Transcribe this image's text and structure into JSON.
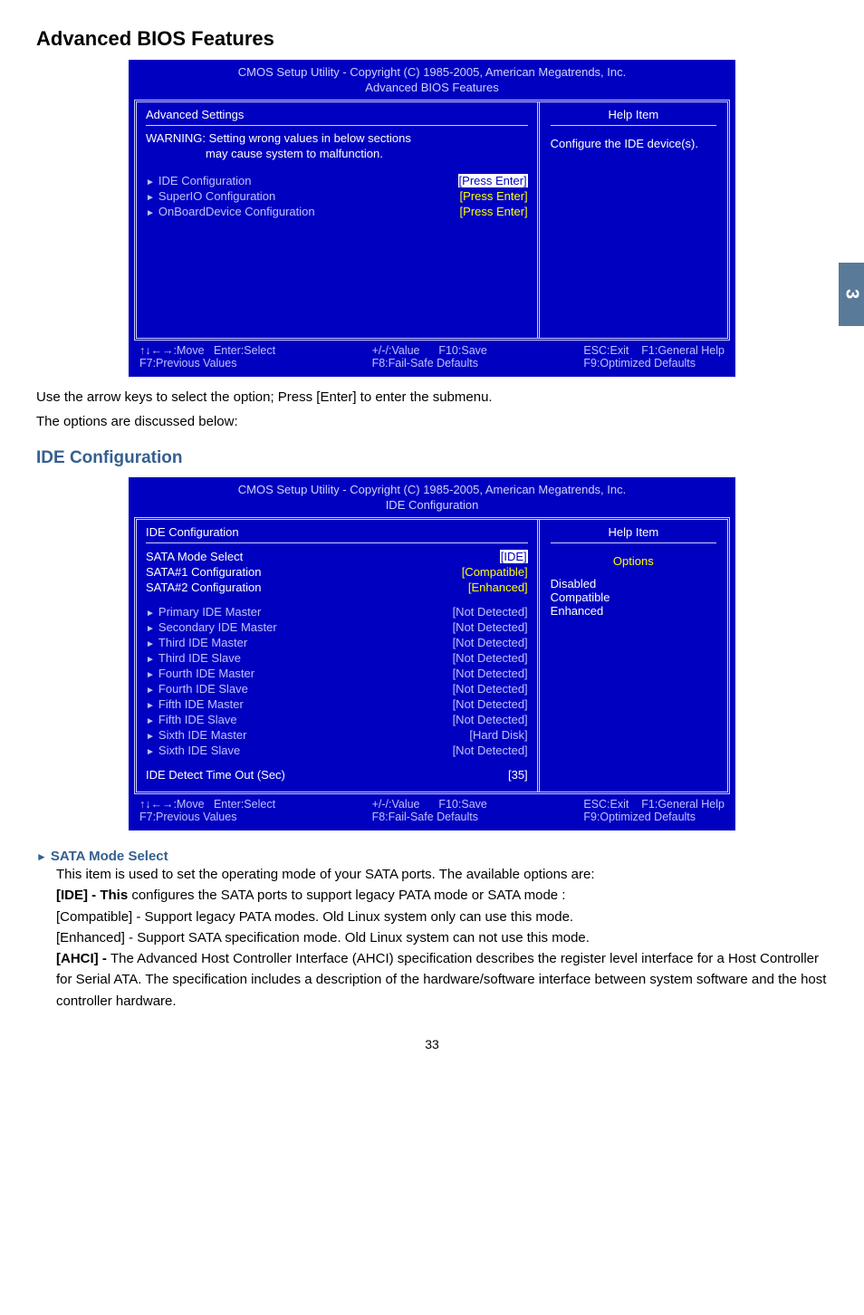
{
  "pageTab": "3",
  "pageNumber": "33",
  "h1": "Advanced BIOS Features",
  "bios1": {
    "titleLine1": "CMOS Setup Utility - Copyright (C) 1985-2005, American Megatrends, Inc.",
    "titleLine2": "Advanced BIOS Features",
    "leftHeader": "Advanced Settings",
    "warningLine1": "WARNING: Setting wrong values in below sections",
    "warningLine2": "may cause system to malfunction.",
    "items": [
      {
        "label": "IDE Configuration",
        "value": "[Press Enter]",
        "selected": true
      },
      {
        "label": "SuperIO Configuration",
        "value": "[Press Enter]",
        "selected": false
      },
      {
        "label": "OnBoardDevice Configuration",
        "value": "[Press Enter]",
        "selected": false
      }
    ],
    "helpTitle": "Help Item",
    "helpText": "Configure the IDE device(s).",
    "footerLeft": "↑↓←→:Move   Enter:Select\nF7:Previous Values",
    "footerMid": "+/-/:Value      F10:Save\nF8:Fail-Safe Defaults",
    "footerRight": "ESC:Exit    F1:General Help\nF9:Optimized Defaults"
  },
  "bodyText1": "Use the arrow keys to select the option; Press [Enter] to enter the submenu.",
  "bodyText2": "The options are discussed below:",
  "h2": "IDE Configuration",
  "bios2": {
    "titleLine1": "CMOS Setup Utility - Copyright (C) 1985-2005, American Megatrends, Inc.",
    "titleLine2": "IDE Configuration",
    "leftHeader": "IDE Configuration",
    "topItems": [
      {
        "label": "SATA Mode Select",
        "value": "[IDE]",
        "tri": false,
        "white": true,
        "selected": true
      },
      {
        "label": "SATA#1 Configuration",
        "value": "[Compatible]",
        "tri": false,
        "white": true
      },
      {
        "label": "SATA#2 Configuration",
        "value": "[Enhanced]",
        "tri": false,
        "white": true
      }
    ],
    "ideItems": [
      {
        "label": "Primary IDE Master",
        "value": "[Not Detected]"
      },
      {
        "label": "Secondary IDE Master",
        "value": "[Not Detected]"
      },
      {
        "label": "Third IDE Master",
        "value": "[Not Detected]"
      },
      {
        "label": "Third IDE Slave",
        "value": "[Not Detected]"
      },
      {
        "label": "Fourth IDE Master",
        "value": "[Not Detected]"
      },
      {
        "label": "Fourth IDE Slave",
        "value": "[Not Detected]"
      },
      {
        "label": "Fifth IDE Master",
        "value": "[Not Detected]"
      },
      {
        "label": "Fifth IDE Slave",
        "value": "[Not Detected]"
      },
      {
        "label": "Sixth IDE Master",
        "value": "[Hard Disk]"
      },
      {
        "label": "Sixth IDE Slave",
        "value": "[Not Detected]"
      }
    ],
    "timeoutLabel": "IDE Detect Time Out (Sec)",
    "timeoutValue": "[35]",
    "helpTitle": "Help Item",
    "optionsHeader": "Options",
    "options": [
      "Disabled",
      "Compatible",
      "Enhanced"
    ],
    "footerLeft": "↑↓←→:Move   Enter:Select\nF7:Previous Values",
    "footerMid": "+/-/:Value      F10:Save\nF8:Fail-Safe Defaults",
    "footerRight": "ESC:Exit    F1:General Help\nF9:Optimized Defaults"
  },
  "sataHead": "SATA Mode Select",
  "desc": {
    "line1": "This item is used to set the operating mode of your SATA ports. The available options are:",
    "line2a": "[IDE] - This",
    "line2b": " configures the SATA ports to support legacy PATA mode or SATA mode :",
    "line3": "[Compatible] - Support legacy PATA modes. Old Linux system only can use this mode.",
    "line4": "[Enhanced] - Support SATA specification mode. Old Linux system can not use this mode.",
    "line5a": "[AHCI] - ",
    "line5b": "The Advanced Host Controller Interface (AHCI) specification describes the register level interface for a Host Controller for Serial ATA. The specification includes a description of the hardware/software interface between system software and the host controller hardware."
  }
}
